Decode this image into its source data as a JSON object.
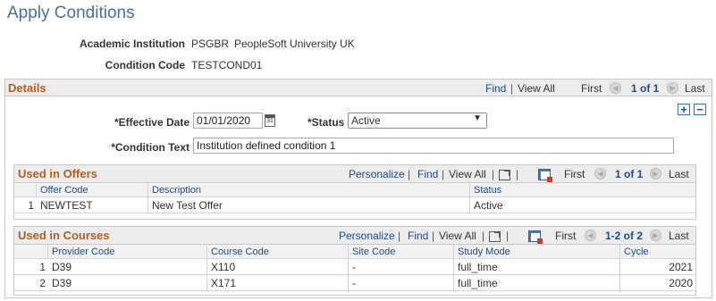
{
  "page": {
    "title": "Apply Conditions"
  },
  "header": {
    "institution_label": "Academic Institution",
    "institution_code": "PSGBR",
    "institution_name": "PeopleSoft University UK",
    "condition_code_label": "Condition Code",
    "condition_code": "TESTCOND01"
  },
  "details": {
    "title": "Details",
    "find": "Find",
    "view_all": "View All",
    "first": "First",
    "count": "1 of 1",
    "last": "Last",
    "effective_date_label": "*Effective Date",
    "effective_date": "01/01/2020",
    "status_label": "*Status",
    "status_value": "Active",
    "condition_text_label": "*Condition Text",
    "condition_text": "Institution defined condition 1",
    "add_symbol": "+",
    "remove_symbol": "−"
  },
  "offers": {
    "title": "Used in Offers",
    "personalize": "Personalize",
    "find": "Find",
    "view_all": "View All",
    "first": "First",
    "count": "1 of 1",
    "last": "Last",
    "columns": [
      "Offer Code",
      "Description",
      "Status"
    ],
    "rows": [
      {
        "num": "1",
        "offer_code": "NEWTEST",
        "description": "New Test Offer",
        "status": "Active"
      }
    ]
  },
  "courses": {
    "title": "Used in Courses",
    "personalize": "Personalize",
    "find": "Find",
    "view_all": "View All",
    "first": "First",
    "count": "1-2 of 2",
    "last": "Last",
    "columns": [
      "Provider Code",
      "Course Code",
      "Site Code",
      "Study Mode",
      "Cycle"
    ],
    "rows": [
      {
        "num": "1",
        "provider": "D39",
        "course": "X110",
        "site": "-",
        "mode": "full_time",
        "cycle": "2021"
      },
      {
        "num": "2",
        "provider": "D39",
        "course": "X171",
        "site": "-",
        "mode": "full_time",
        "cycle": "2020"
      }
    ]
  },
  "icons": {
    "nav_prev": "◀",
    "nav_next": "▶",
    "calendar": "31",
    "dropdown": "▼"
  },
  "colors": {
    "title": "#4a6fa0",
    "section": "#b35e1e",
    "link": "#1a4d8a"
  }
}
